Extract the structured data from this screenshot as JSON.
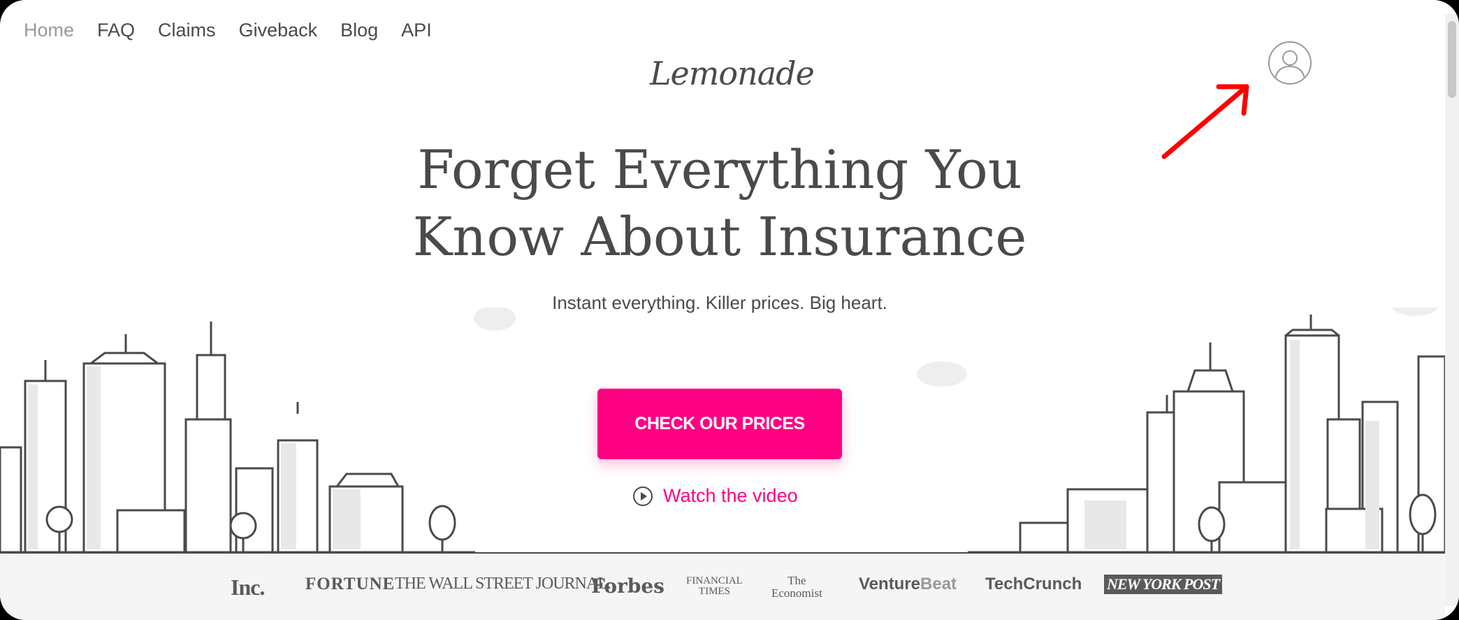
{
  "nav": {
    "items": [
      "Home",
      "FAQ",
      "Claims",
      "Giveback",
      "Blog",
      "API"
    ],
    "active": "Home"
  },
  "brand": {
    "logo": "Lemonade"
  },
  "hero": {
    "headline_line1": "Forget Everything You",
    "headline_line2": "Know About Insurance",
    "subheadline": "Instant everything. Killer prices. Big heart.",
    "cta_label": "CHECK OUR PRICES",
    "video_label": "Watch the video"
  },
  "press": {
    "logos": [
      "Inc.",
      "FORTUNE",
      "THE WALL STREET JOURNAL.",
      "Forbes",
      "FINANCIAL TIMES",
      "The Economist",
      "VentureBeat",
      "TechCrunch",
      "NEW YORK POST"
    ],
    "ft_line1": "FINANCIAL",
    "ft_line2": "TIMES",
    "economist_line1": "The",
    "economist_line2": "Economist",
    "vb_a": "Venture",
    "vb_b": "Beat"
  },
  "icons": {
    "avatar": "user-avatar-icon",
    "play": "play-circle-icon",
    "annotation": "red-arrow"
  },
  "colors": {
    "accent": "#ff0083",
    "text": "#4a4a4a",
    "muted": "#9a9a9a",
    "annotation": "#ff0000"
  }
}
